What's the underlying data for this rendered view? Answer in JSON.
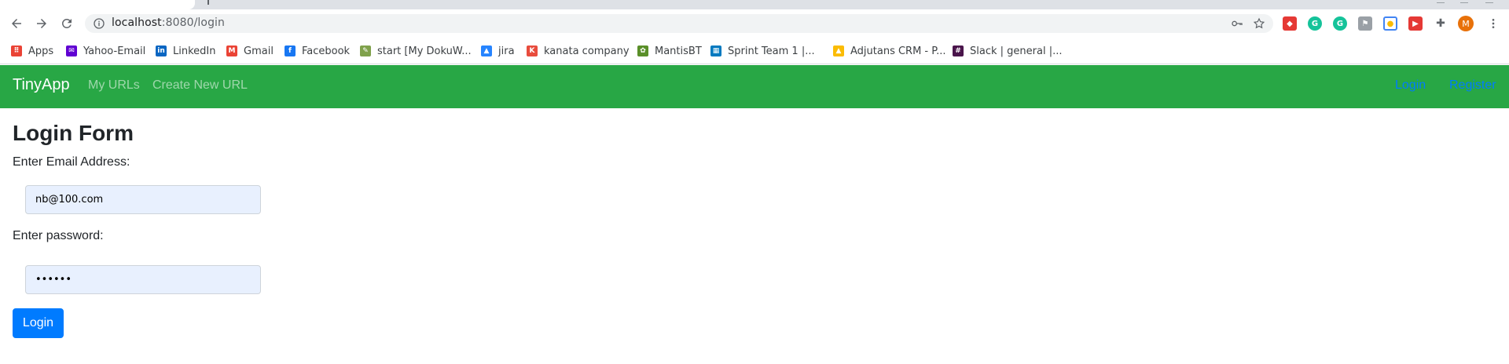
{
  "browser": {
    "url_host": "localhost",
    "url_path": ":8080/login",
    "avatar_letter": "M",
    "bookmarks": [
      {
        "label": "Apps",
        "icon": "apps-grid-icon",
        "color": "#ea4335"
      },
      {
        "label": "Yahoo-Email",
        "icon": "yahoo-mail-icon",
        "color": "#6001d2"
      },
      {
        "label": "LinkedIn",
        "icon": "linkedin-icon",
        "color": "#0a66c2"
      },
      {
        "label": "Gmail",
        "icon": "gmail-icon",
        "color": "#ea4335"
      },
      {
        "label": "Facebook",
        "icon": "facebook-icon",
        "color": "#1877f2"
      },
      {
        "label": "start [My DokuW...",
        "icon": "dokuwiki-icon",
        "color": "#7fa14b"
      },
      {
        "label": "jira",
        "icon": "jira-icon",
        "color": "#2684ff"
      },
      {
        "label": "kanata company",
        "icon": "kanata-icon",
        "color": "#e84c3d"
      },
      {
        "label": "MantisBT",
        "icon": "mantis-icon",
        "color": "#5a8f29"
      },
      {
        "label": "Sprint Team 1 |...",
        "icon": "trello-icon",
        "color": "#0079bf"
      },
      {
        "label": "Adjutans CRM - P...",
        "icon": "google-drive-icon",
        "color": "#fbbc04"
      },
      {
        "label": "Slack | general |...",
        "icon": "slack-icon",
        "color": "#4a154b"
      }
    ]
  },
  "navbar": {
    "brand": "TinyApp",
    "links": [
      "My URLs",
      "Create New URL"
    ],
    "right_links": [
      "Login",
      "Register"
    ],
    "bg_color": "#28a745"
  },
  "form": {
    "title": "Login Form",
    "email_label": "Enter Email Address:",
    "email_value": "nb@100.com",
    "password_label": "Enter password:",
    "password_value": "••••••",
    "submit_label": "Login"
  }
}
